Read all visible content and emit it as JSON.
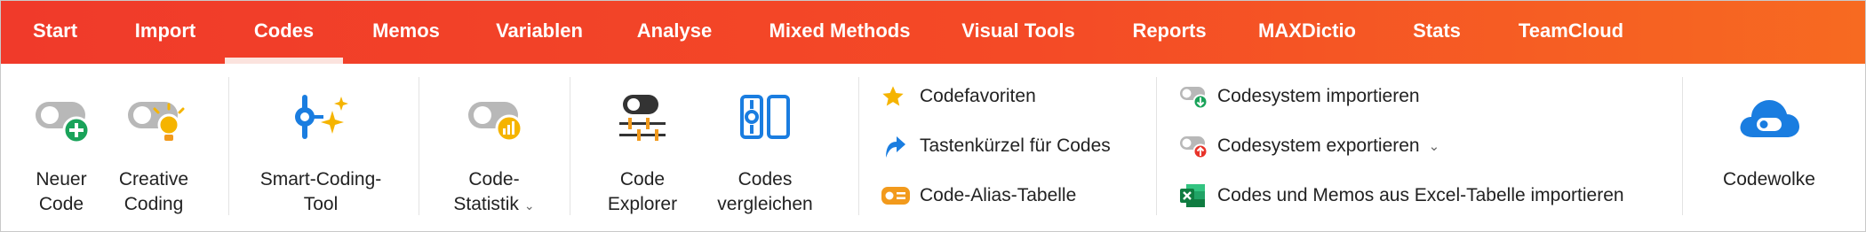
{
  "menu": {
    "tabs": [
      "Start",
      "Import",
      "Codes",
      "Memos",
      "Variablen",
      "Analyse",
      "Mixed Methods",
      "Visual Tools",
      "Reports",
      "MAXDictio",
      "Stats",
      "TeamCloud"
    ],
    "active": "Codes"
  },
  "ribbon": {
    "neuer_code": {
      "line1": "Neuer",
      "line2": "Code",
      "icon": "toggle-plus-icon"
    },
    "creative_coding": {
      "line1": "Creative",
      "line2": "Coding",
      "icon": "toggle-lightbulb-icon"
    },
    "smart_coding": {
      "line1": "Smart-Coding-",
      "line2": "Tool",
      "icon": "sparkle-code-icon"
    },
    "code_statistik": {
      "line1": "Code-",
      "line2": "Statistik",
      "caret": "⌄",
      "icon": "toggle-chart-icon"
    },
    "code_explorer": {
      "line1": "Code",
      "line2": "Explorer",
      "icon": "explorer-icon"
    },
    "codes_vergleichen": {
      "line1": "Codes",
      "line2": "vergleichen",
      "icon": "compare-icon"
    },
    "codefavoriten": {
      "label": "Codefavoriten",
      "icon": "star-icon"
    },
    "tastenkuerzel": {
      "label": "Tastenkürzel für Codes",
      "icon": "shortcut-arrow-icon"
    },
    "code_alias": {
      "label": "Code-Alias-Tabelle",
      "icon": "alias-table-icon"
    },
    "codesystem_importieren": {
      "label": "Codesystem importieren",
      "icon": "toggle-import-icon"
    },
    "codesystem_exportieren": {
      "label": "Codesystem exportieren",
      "caret": "⌄",
      "icon": "toggle-export-icon"
    },
    "excel_import": {
      "label": "Codes und Memos aus Excel-Tabelle importieren",
      "icon": "excel-icon"
    },
    "codewolke": {
      "label": "Codewolke",
      "icon": "cloud-icon"
    }
  },
  "colors": {
    "brand_red": "#f03a2a",
    "brand_orange": "#f76a21",
    "icon_blue": "#1a7de0",
    "icon_gray": "#b8b8b8",
    "green": "#1aa35a",
    "yellow": "#f5b400",
    "orange": "#f29a1c"
  }
}
